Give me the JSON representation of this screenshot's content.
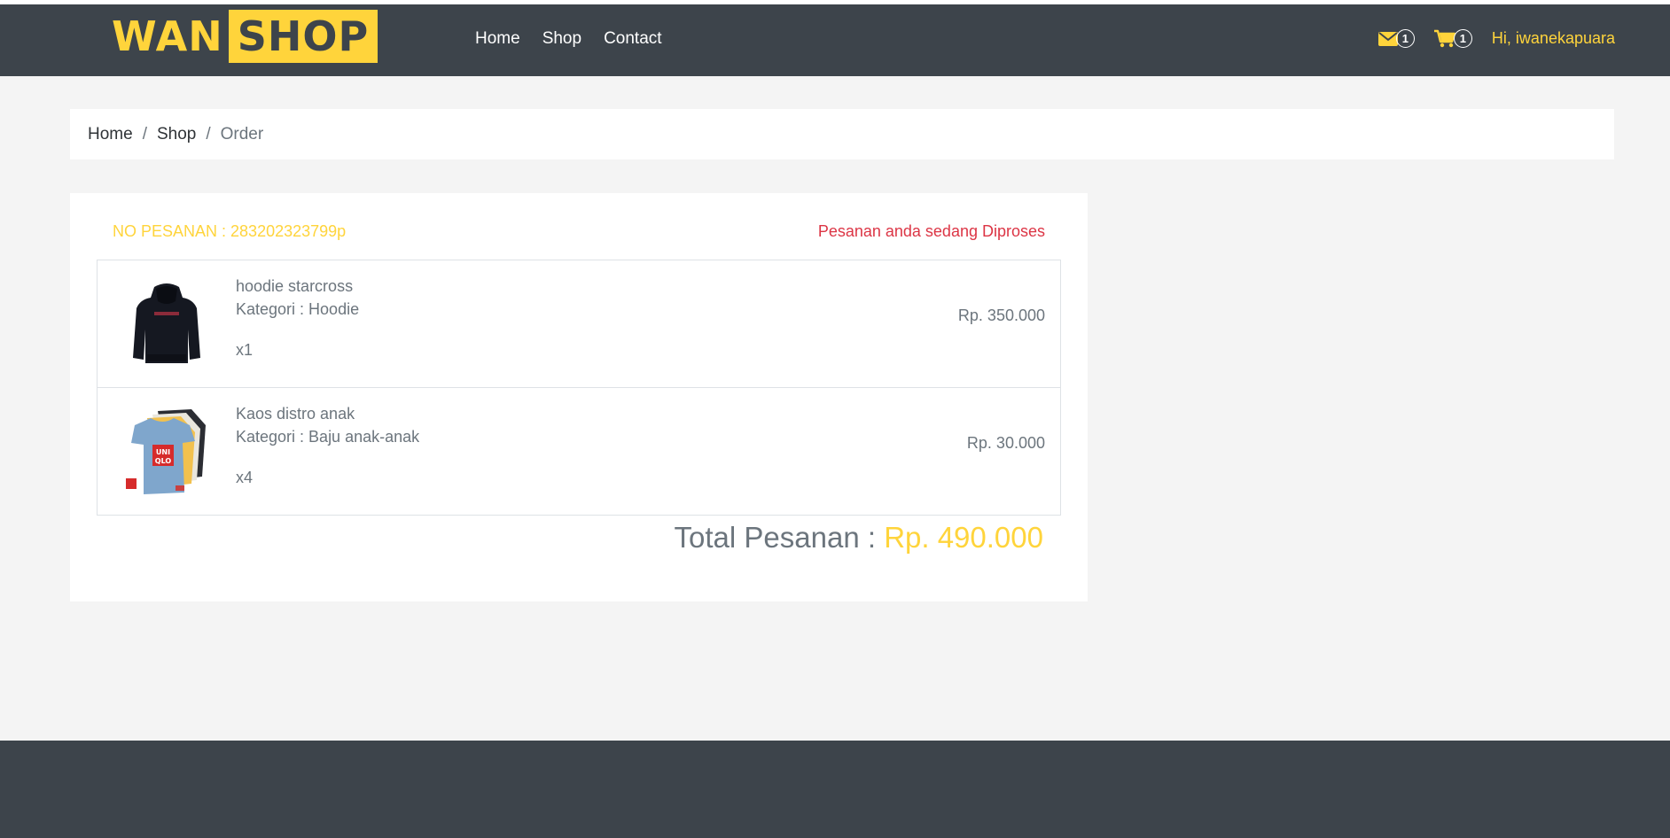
{
  "brand": {
    "part1": "WAN",
    "part2": "SHOP"
  },
  "nav": {
    "home": "Home",
    "shop": "Shop",
    "contact": "Contact"
  },
  "header": {
    "message_count": "1",
    "cart_count": "1",
    "greeting": "Hi, iwanekapuara"
  },
  "colors": {
    "accent": "#ffd43b",
    "navbar": "#3d444b",
    "status": "#dc3545"
  },
  "breadcrumb": {
    "home": "Home",
    "shop": "Shop",
    "current": "Order"
  },
  "order": {
    "number_text": "NO PESANAN : 283202323799p",
    "status_text": "Pesanan anda sedang Diproses",
    "items": [
      {
        "name": "hoodie starcross",
        "category": "Kategori : Hoodie",
        "qty": "x1",
        "price": "Rp. 350.000",
        "image": "black-hoodie"
      },
      {
        "name": "Kaos distro anak",
        "category": "Kategori : Baju anak-anak",
        "qty": "x4",
        "price": "Rp. 30.000",
        "image": "uniqlo-kids-tshirts"
      }
    ],
    "total_label": "Total Pesanan : ",
    "total_value": "Rp. 490.000"
  }
}
